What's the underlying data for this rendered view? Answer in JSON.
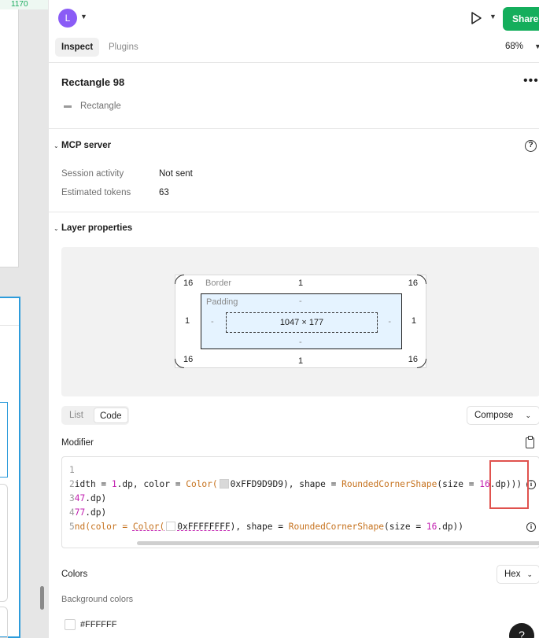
{
  "canvas": {
    "ruler_number": "1170"
  },
  "topbar": {
    "avatar_letter": "L",
    "share_label": "Share",
    "colors": {
      "accent": "#14ae5c",
      "avatar": "#8a5cf6"
    }
  },
  "tabs": {
    "inspect": "Inspect",
    "plugins": "Plugins",
    "zoom": "68%"
  },
  "layer": {
    "title": "Rectangle 98",
    "type": "Rectangle"
  },
  "mcp": {
    "title": "MCP server",
    "rows": [
      {
        "label": "Session activity",
        "value": "Not sent"
      },
      {
        "label": "Estimated tokens",
        "value": "63"
      }
    ]
  },
  "props": {
    "title": "Layer properties",
    "box_model": {
      "border_label": "Border",
      "border_top": "1",
      "border_bottom": "1",
      "border_left": "1",
      "border_right": "1",
      "radius_tl": "16",
      "radius_tr": "16",
      "radius_bl": "16",
      "radius_br": "16",
      "padding_label": "Padding",
      "padding_top": "-",
      "padding_bottom": "-",
      "padding_left": "-",
      "padding_right": "-",
      "size": "1047 × 177"
    },
    "view_toggle": {
      "list": "List",
      "code": "Code"
    },
    "framework": "Compose",
    "modifier_label": "Modifier",
    "code_lines": {
      "l1_num": "1",
      "l2_num": "2",
      "l2_a": "idth = ",
      "l2_b": "1",
      "l2_c": ".dp, color = ",
      "l2_d": "Color(",
      "l2_e": "0xFFD9D9D9",
      "l2_f": "), shape = ",
      "l2_g": "RoundedCornerShape",
      "l2_h": "(size = ",
      "l2_i": "16",
      "l2_j": ".dp)))",
      "l3_num": "3",
      "l3_a": "47",
      "l3_b": ".dp)",
      "l4_num": "4",
      "l4_a": "77",
      "l4_b": ".dp)",
      "l5_num": "5",
      "l5_a": "nd(color = ",
      "l5_b": "Color(",
      "l5_c": "0xFFFFFFFF",
      "l5_d": "), shape = ",
      "l5_e": "RoundedCornerShape",
      "l5_f": "(size = ",
      "l5_g": "16",
      "l5_h": ".dp))"
    },
    "colors_label": "Colors",
    "color_format": "Hex",
    "background_colors_label": "Background colors",
    "background_color_value": "#FFFFFF",
    "swatch_colors": {
      "gray": "#D9D9D9",
      "white": "#FFFFFF"
    }
  },
  "help_fab": "?"
}
